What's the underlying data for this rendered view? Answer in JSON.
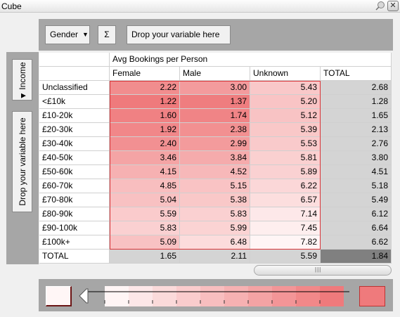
{
  "window": {
    "title": "Cube",
    "close_glyph": "✕"
  },
  "toolbar": {
    "gender_label": "Gender",
    "sigma_label": "Σ",
    "drop_column_label": "Drop your variable here"
  },
  "rows_panel": {
    "income_label": "Income",
    "drop_row_label": "Drop your variable here"
  },
  "pivot": {
    "measure_label": "Avg Bookings per Person",
    "columns": [
      "Female",
      "Male",
      "Unknown",
      "TOTAL"
    ],
    "rows": [
      {
        "label": "Unclassified",
        "values": [
          "2.22",
          "3.00",
          "5.43",
          "2.68"
        ]
      },
      {
        "label": "<£10k",
        "values": [
          "1.22",
          "1.37",
          "5.20",
          "1.28"
        ]
      },
      {
        "label": "£10-20k",
        "values": [
          "1.60",
          "1.74",
          "5.12",
          "1.65"
        ]
      },
      {
        "label": "£20-30k",
        "values": [
          "1.92",
          "2.38",
          "5.39",
          "2.13"
        ]
      },
      {
        "label": "£30-40k",
        "values": [
          "2.40",
          "2.99",
          "5.53",
          "2.76"
        ]
      },
      {
        "label": "£40-50k",
        "values": [
          "3.46",
          "3.84",
          "5.81",
          "3.80"
        ]
      },
      {
        "label": "£50-60k",
        "values": [
          "4.15",
          "4.52",
          "5.89",
          "4.51"
        ]
      },
      {
        "label": "£60-70k",
        "values": [
          "4.85",
          "5.15",
          "6.22",
          "5.18"
        ]
      },
      {
        "label": "£70-80k",
        "values": [
          "5.04",
          "5.38",
          "6.57",
          "5.49"
        ]
      },
      {
        "label": "£80-90k",
        "values": [
          "5.59",
          "5.83",
          "7.14",
          "6.12"
        ]
      },
      {
        "label": "£90-100k",
        "values": [
          "5.83",
          "5.99",
          "7.45",
          "6.64"
        ]
      },
      {
        "label": "£100k+",
        "values": [
          "5.09",
          "6.48",
          "7.82",
          "6.62"
        ]
      }
    ],
    "total_row": {
      "label": "TOTAL",
      "values": [
        "1.65",
        "2.11",
        "5.59",
        "1.84"
      ]
    }
  },
  "colors": {
    "heat_low": "#fff5f5",
    "heat_high": "#ef7a7c",
    "total_cell": "#d4d4d4",
    "grand_total": "#808080",
    "selection_border": "#d9363a",
    "panel_gray": "#a6a6a6"
  },
  "icons": {
    "pin": "pin-icon",
    "close": "close-icon",
    "dropdown": "chevron-down-icon",
    "scroll_grip": "grip-icon"
  },
  "legend": {
    "slider": "color-scale-slider"
  }
}
